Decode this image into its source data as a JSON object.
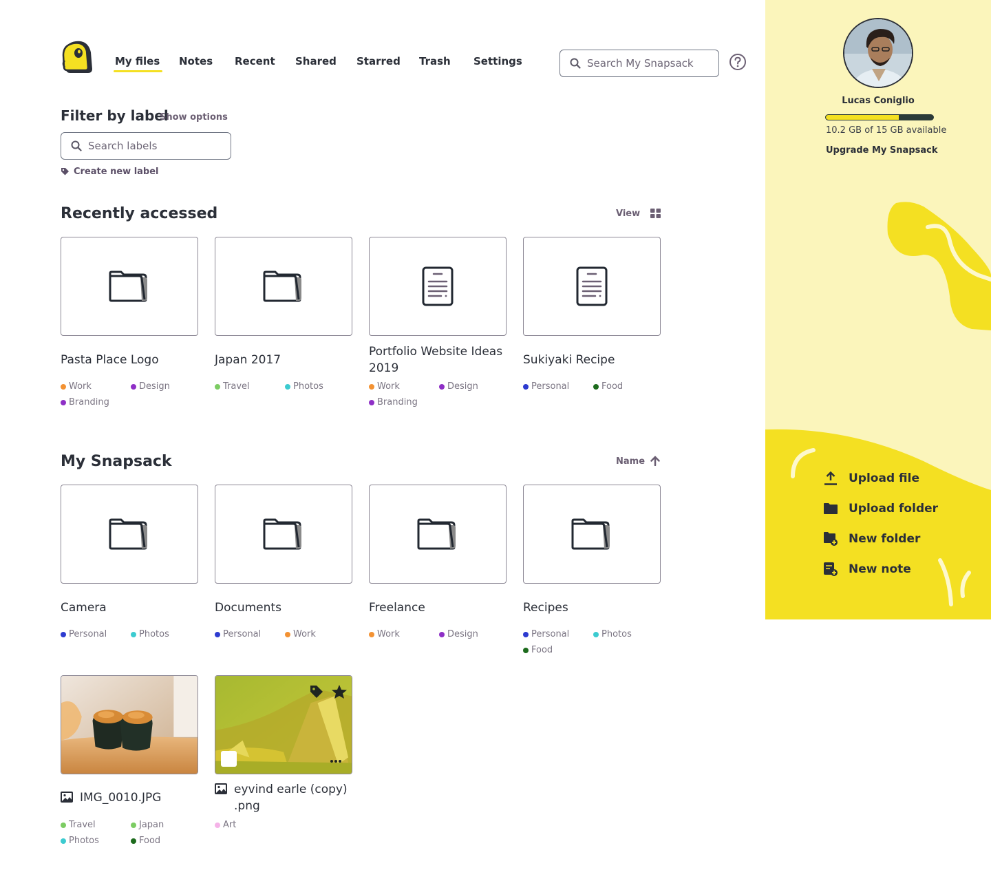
{
  "nav": {
    "items": [
      {
        "label": "My files",
        "active": true
      },
      {
        "label": "Notes"
      },
      {
        "label": "Recent"
      },
      {
        "label": "Shared"
      },
      {
        "label": "Starred"
      },
      {
        "label": "Trash"
      },
      {
        "label": "Settings"
      }
    ],
    "search_placeholder": "Search My Snapsack"
  },
  "filter": {
    "title": "Filter by label",
    "show_options": "Show options",
    "search_placeholder": "Search labels",
    "create_label": "Create new label"
  },
  "recent": {
    "title": "Recently accessed",
    "view_label": "View",
    "items": [
      {
        "type": "folder",
        "title": "Pasta Place Logo",
        "labels": [
          {
            "name": "Work",
            "color": "#f39233"
          },
          {
            "name": "Design",
            "color": "#8e2fc6"
          },
          {
            "name": "Branding",
            "color": "#8e2fc6"
          }
        ]
      },
      {
        "type": "folder",
        "title": "Japan 2017",
        "labels": [
          {
            "name": "Travel",
            "color": "#7ccc63"
          },
          {
            "name": "Photos",
            "color": "#3ccbd0"
          }
        ]
      },
      {
        "type": "note",
        "title": "Portfolio Website Ideas 2019",
        "labels": [
          {
            "name": "Work",
            "color": "#f39233"
          },
          {
            "name": "Design",
            "color": "#8e2fc6"
          },
          {
            "name": "Branding",
            "color": "#8e2fc6"
          }
        ]
      },
      {
        "type": "note",
        "title": "Sukiyaki Recipe",
        "labels": [
          {
            "name": "Personal",
            "color": "#2d3bd0"
          },
          {
            "name": "Food",
            "color": "#1d6b1d"
          }
        ]
      }
    ]
  },
  "snapsack": {
    "title": "My Snapsack",
    "sort_label": "Name",
    "folders": [
      {
        "title": "Camera",
        "labels": [
          {
            "name": "Personal",
            "color": "#2d3bd0"
          },
          {
            "name": "Photos",
            "color": "#3ccbd0"
          }
        ]
      },
      {
        "title": "Documents",
        "labels": [
          {
            "name": "Personal",
            "color": "#2d3bd0"
          },
          {
            "name": "Work",
            "color": "#f39233"
          }
        ]
      },
      {
        "title": "Freelance",
        "labels": [
          {
            "name": "Work",
            "color": "#f39233"
          },
          {
            "name": "Design",
            "color": "#8e2fc6"
          }
        ]
      },
      {
        "title": "Recipes",
        "labels": [
          {
            "name": "Personal",
            "color": "#2d3bd0"
          },
          {
            "name": "Photos",
            "color": "#3ccbd0"
          },
          {
            "name": "Food",
            "color": "#1d6b1d"
          }
        ]
      }
    ],
    "images": [
      {
        "title": "IMG_0010.JPG",
        "labels": [
          {
            "name": "Travel",
            "color": "#7ccc63"
          },
          {
            "name": "Japan",
            "color": "#7ccc63"
          },
          {
            "name": "Photos",
            "color": "#3ccbd0"
          },
          {
            "name": "Food",
            "color": "#1d6b1d"
          }
        ]
      },
      {
        "title": "eyvind earle (copy) .png",
        "labels": [
          {
            "name": "Art",
            "color": "#f5b3e8"
          }
        ]
      }
    ]
  },
  "user": {
    "name": "Lucas Coniglio",
    "storage_used_fraction": 0.68,
    "storage_text": "10.2 GB of 15 GB available",
    "upgrade": "Upgrade My Snapsack"
  },
  "actions": {
    "upload_file": "Upload file",
    "upload_folder": "Upload folder",
    "new_folder": "New folder",
    "new_note": "New note"
  },
  "colors": {
    "accent_yellow": "#f4e022",
    "panel_bg": "#fbf5bb",
    "text_dark": "#2b2f38"
  }
}
